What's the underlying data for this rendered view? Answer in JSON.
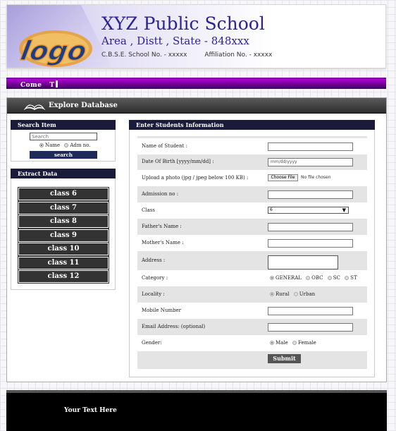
{
  "header": {
    "logo_text": "logo",
    "school_name": "XYZ Public School",
    "address": "Area , Distt , State - 848xxx",
    "cbse_no": "C.B.S.E. School No. - xxxxx",
    "affiliation_no": "Affiliation No. - xxxxx"
  },
  "marquee": {
    "text": "Come   T"
  },
  "explore": {
    "title": "Explore Database"
  },
  "search": {
    "title": "Search Item",
    "placeholder": "Search",
    "options": [
      "Name",
      "Adm no."
    ],
    "selected": "Name",
    "button": "search"
  },
  "extract": {
    "title": "Extract Data",
    "classes": [
      "class 6",
      "class 7",
      "class 8",
      "class 9",
      "class 10",
      "class 11",
      "class 12"
    ]
  },
  "form": {
    "title": "Enter Students Information",
    "labels": {
      "name": "Name of Student :",
      "dob": "Date Of Birth [yyyy/mm/dd] :",
      "photo": "Upload a photo (jpg / jpeg below 100 KB) :",
      "admission": "Admission no :",
      "class": "Class",
      "father": "Father's Name :",
      "mother": "Mother's Name :",
      "address": "Address :",
      "category": "Category :",
      "locality": "Locality :",
      "mobile": "Mobile Number",
      "email": "Email Address: (optional)",
      "gender": "Gender:"
    },
    "dob_placeholder": "mm/dd/yyyy",
    "file_button": "Choose File",
    "file_status": "No file chosen",
    "class_value": "6",
    "category_options": [
      "GENERAL",
      "OBC",
      "SC",
      "ST"
    ],
    "category_selected": "GENERAL",
    "locality_options": [
      "Rural",
      "Urban"
    ],
    "locality_selected": "Rural",
    "gender_options": [
      "Male",
      "Female"
    ],
    "gender_selected": "Male",
    "submit": "Submit"
  },
  "footer": {
    "text": "Your Text Here"
  }
}
